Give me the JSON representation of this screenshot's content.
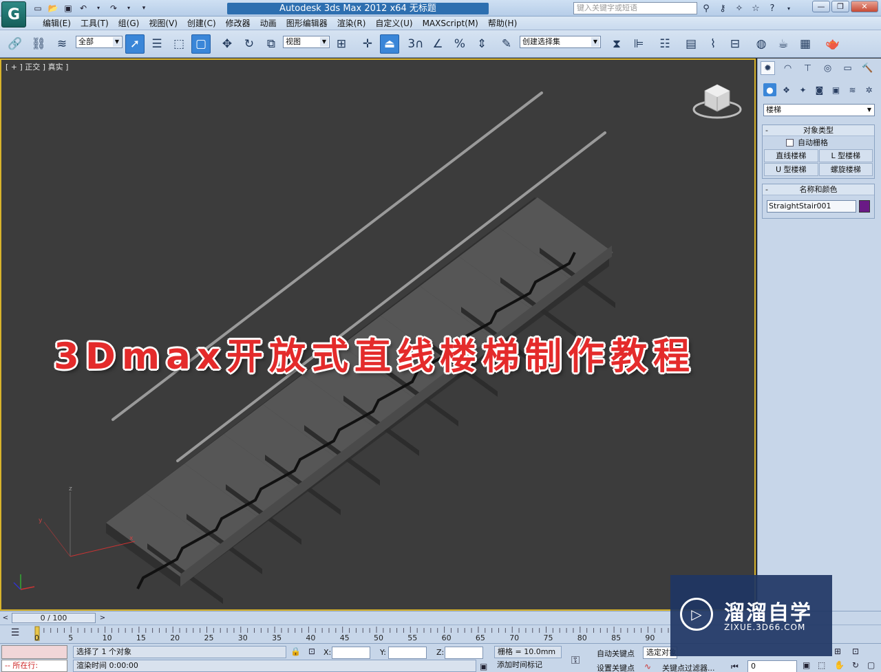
{
  "titlebar": {
    "app_logo": "G",
    "title": "Autodesk 3ds Max  2012 x64      无标题",
    "search_placeholder": "键入关键字或短语"
  },
  "menus": [
    "编辑(E)",
    "工具(T)",
    "组(G)",
    "视图(V)",
    "创建(C)",
    "修改器",
    "动画",
    "图形编辑器",
    "渲染(R)",
    "自定义(U)",
    "MAXScript(M)",
    "帮助(H)"
  ],
  "toolbar": {
    "selection_filter": "全部",
    "ref_coord": "视图",
    "named_selection": "创建选择集"
  },
  "viewport": {
    "label": "[ + ] 正交 ] 真实 ]",
    "overlay_title": "3Dmax开放式直线楼梯制作教程",
    "axis_x": "x",
    "axis_y": "y",
    "axis_z": "z"
  },
  "command_panel": {
    "category": "楼梯",
    "object_type_title": "对象类型",
    "autogrid_label": "自动栅格",
    "object_buttons": [
      "直线楼梯",
      "L 型楼梯",
      "U 型楼梯",
      "螺旋楼梯"
    ],
    "name_color_title": "名称和颜色",
    "object_name": "StraightStair001",
    "object_color": "#6a1a86"
  },
  "timeline": {
    "frame_display": "0 / 100",
    "ticks": [
      "0",
      "5",
      "10",
      "15",
      "20",
      "25",
      "30",
      "35",
      "40",
      "45",
      "50",
      "55",
      "60",
      "65",
      "70",
      "75",
      "80",
      "85",
      "90"
    ]
  },
  "status": {
    "listener_text": "-- 所在行:",
    "selection_status": "选择了 1 个对象",
    "prompt": "渲染时间  0:00:00",
    "x_label": "X:",
    "y_label": "Y:",
    "z_label": "Z:",
    "grid": "栅格 = 10.0mm",
    "add_time_tag": "添加时间标记",
    "auto_key": "自动关键点",
    "set_key": "设置关键点",
    "key_mode": "选定对象",
    "key_filters": "关键点过滤器...",
    "current_frame": "0"
  },
  "watermark": {
    "brand": "溜溜自学",
    "url": "ZIXUE.3D66.COM"
  },
  "colors": {
    "viewport_border": "#d8b42c",
    "overlay_text": "#e42b2b",
    "ui_bg": "#c7d6e9"
  }
}
